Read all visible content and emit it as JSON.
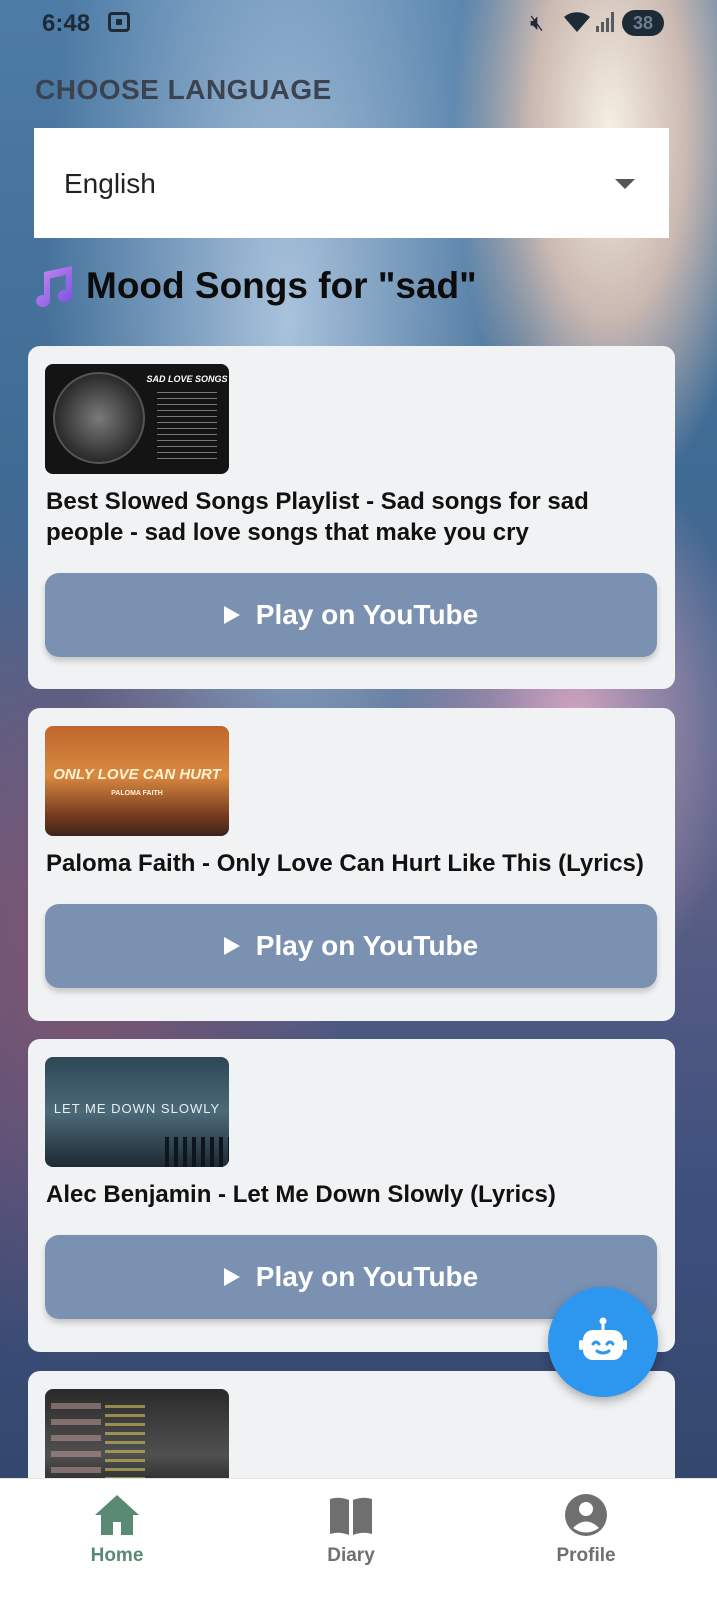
{
  "status_bar": {
    "time": "6:48",
    "battery": "38"
  },
  "language": {
    "heading": "CHOOSE LANGUAGE",
    "selected": "English"
  },
  "mood": {
    "title": "Mood Songs for \"sad\""
  },
  "songs": [
    {
      "title": "Best Slowed Songs Playlist - Sad songs for sad people - sad love songs that make you cry",
      "thumb_text": "SAD LOVE SONGS",
      "play_label": "Play on YouTube"
    },
    {
      "title": "Paloma Faith - Only Love Can Hurt Like This (Lyrics)",
      "thumb_text": "ONLY LOVE CAN HURT",
      "thumb_sub": "PALOMA FAITH",
      "play_label": "Play on YouTube"
    },
    {
      "title": "Alec Benjamin - Let Me Down Slowly (Lyrics)",
      "thumb_text": "LET ME DOWN SLOWLY",
      "play_label": "Play on YouTube"
    }
  ],
  "nav": {
    "items": [
      {
        "label": "Home",
        "color": "#5a8a74",
        "active": true
      },
      {
        "label": "Diary",
        "color": "#6f6f6f",
        "active": false
      },
      {
        "label": "Profile",
        "color": "#6f6f6f",
        "active": false
      }
    ]
  }
}
